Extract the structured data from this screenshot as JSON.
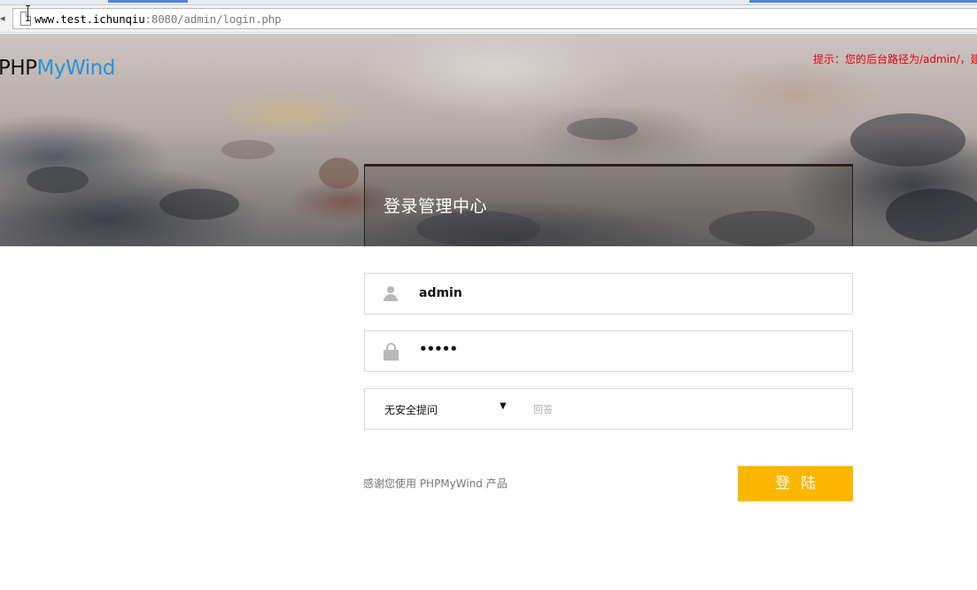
{
  "browser": {
    "url_host": "www.test.ichunqiu",
    "url_rest": ":8080/admin/login.php"
  },
  "header": {
    "logo_left": "PHP",
    "logo_right": "MyWind",
    "tip": "提示：您的后台路径为/admin/，建"
  },
  "login": {
    "title": "登录管理中心",
    "username_value": "admin",
    "password_mask": "•••••",
    "question_selected": "无安全提问",
    "answer_placeholder": "回答",
    "submit_label": "登陆"
  },
  "footer": {
    "thanks": "感谢您使用 PHPMyWind 产品"
  },
  "colors": {
    "logo_blue": "#2b93d6",
    "tip_red": "#e60012",
    "button_yellow": "#fdb701"
  }
}
